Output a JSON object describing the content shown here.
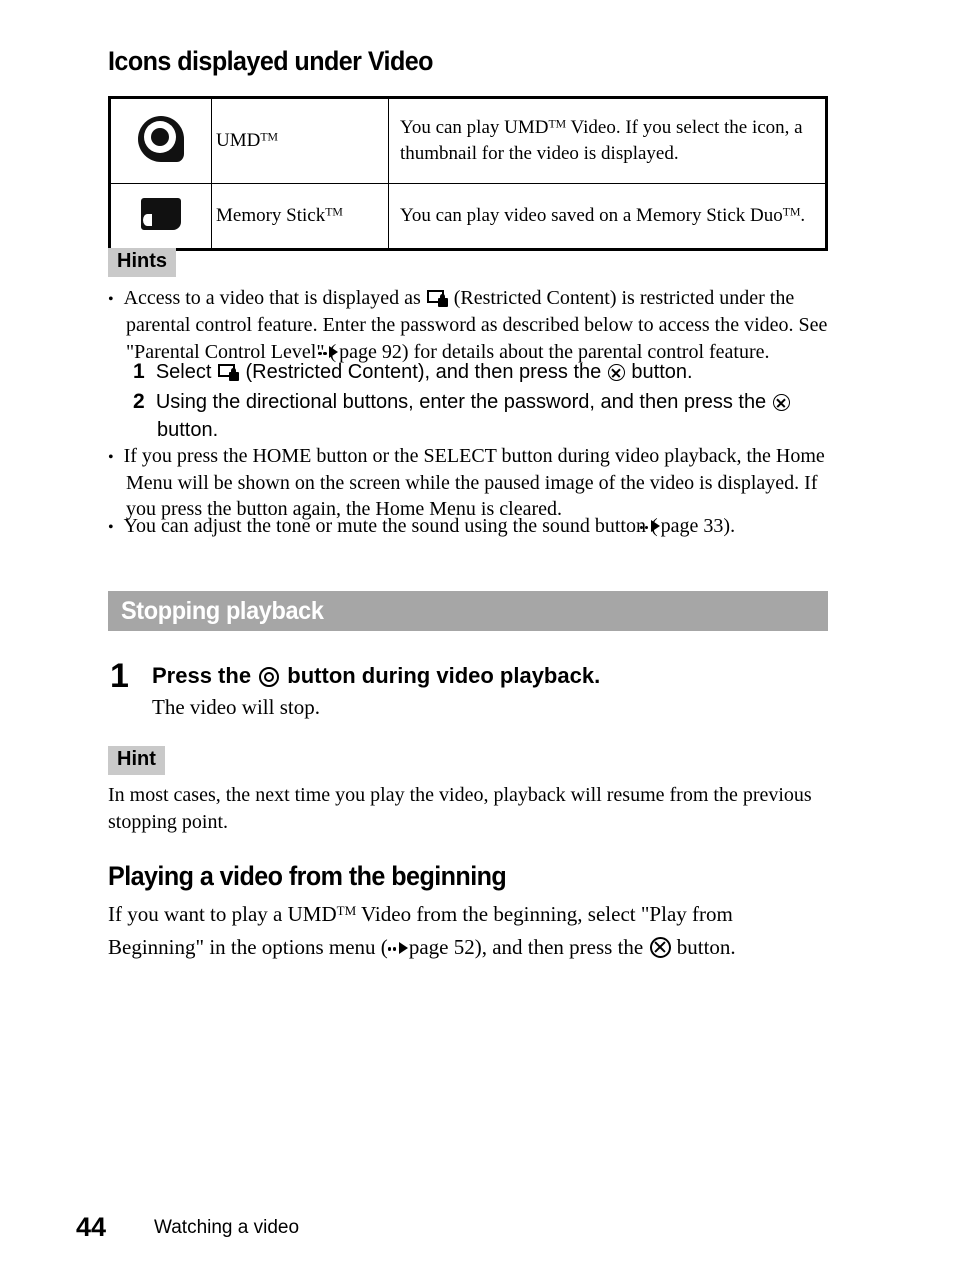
{
  "document": {
    "page_number": "44",
    "footer_title": "Watching a video"
  },
  "colors": {
    "section_bar_bg": "#a6a6a6",
    "section_bar_text": "#ffffff",
    "chip_bg": "#c9c9c9",
    "text": "#000000",
    "page_bg": "#ffffff"
  },
  "sections": {
    "icons_heading": "Icons displayed under Video",
    "stopping_playback_heading": "Stopping playback",
    "playing_from_beginning_heading": "Playing a video from the beginning"
  },
  "icon_table": {
    "rows": [
      {
        "icon_name": "umd-disc-icon",
        "label_prefix": "UMD",
        "label_tm": "TM",
        "description_line1_a": "You can play UMD",
        "description_line1_tm": "TM",
        "description_line1_b": " Video. If you select the icon, a",
        "description_line2": "thumbnail for the video is displayed."
      },
      {
        "icon_name": "memory-stick-icon",
        "label_prefix": "Memory Stick",
        "label_tm": "TM",
        "description_a": "You can play video saved on a Memory Stick Duo",
        "description_tm": "TM",
        "description_b": "."
      }
    ]
  },
  "hints_block": {
    "chip_label": "Hints",
    "bullet1": {
      "text_a": "Access to a video that is displayed as ",
      "icon": "restricted-content-icon",
      "text_b": " (Restricted Content) is restricted under the parental control feature. Enter the password as described below to access the video. See \"Parental Control Level\" (",
      "pageref_icon": "page-reference-arrow-icon",
      "text_c": "page 92) for details about the parental control feature."
    },
    "steps": [
      {
        "number": "1",
        "text_a": "Select ",
        "icon": "restricted-content-icon",
        "text_b": " (Restricted Content), and then press the ",
        "button_icon": "cross-button-icon",
        "text_c": " button."
      },
      {
        "number": "2",
        "text_a": "Using the directional buttons, enter the password, and then press the ",
        "button_icon": "cross-button-icon",
        "text_c": " button."
      }
    ],
    "bullet2": "If you press the HOME button or the SELECT button during video playback, the Home Menu will be shown on the screen while the paused image of the video is displayed. If you press the button again, the Home Menu is cleared.",
    "bullet3": {
      "text_a": "You can adjust the tone or mute the sound using the sound button (",
      "pageref_icon": "page-reference-arrow-icon",
      "text_b": "page 33)."
    }
  },
  "stopping_playback": {
    "step_number": "1",
    "step_title_a": "Press the ",
    "step_title_button_icon": "circle-button-icon",
    "step_title_b": " button during video playback.",
    "step_sub": "The video will stop.",
    "hint_chip_label": "Hint",
    "hint_line1": "In most cases, the next time you play the video, playback will resume from the previous",
    "hint_line2": "stopping point."
  },
  "playing_from_beginning": {
    "text_a": "If you want to play a UMD",
    "tm": "TM",
    "text_b": " Video from the beginning, select \"Play from Beginning\" in the options menu (",
    "pageref_icon": "page-reference-arrow-icon",
    "text_c": "page 52), and then press the ",
    "button_icon": "cross-button-icon",
    "text_d": " button."
  }
}
